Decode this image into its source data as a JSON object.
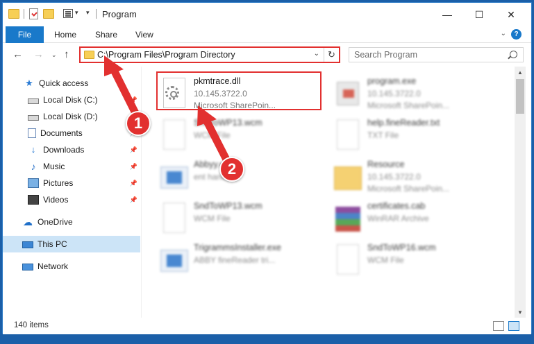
{
  "window": {
    "title": "Program",
    "minimize": "—",
    "maximize": "☐",
    "close": "✕"
  },
  "ribbon": {
    "file": "File",
    "home": "Home",
    "share": "Share",
    "view": "View",
    "help": "?"
  },
  "nav": {
    "back": "←",
    "forward": "→",
    "up": "↑",
    "address": "C:\\Program Files\\Program Directory",
    "refresh": "↻",
    "search_placeholder": "Search Program"
  },
  "sidebar": {
    "items": [
      {
        "label": "Quick access",
        "icon": "star-icon",
        "pinned": false
      },
      {
        "label": "Local Disk (C:)",
        "icon": "drive-icon",
        "pinned": true
      },
      {
        "label": "Local Disk (D:)",
        "icon": "drive-icon",
        "pinned": false
      },
      {
        "label": "Documents",
        "icon": "document-icon",
        "pinned": true
      },
      {
        "label": "Downloads",
        "icon": "download-icon",
        "pinned": true
      },
      {
        "label": "Music",
        "icon": "music-icon",
        "pinned": true
      },
      {
        "label": "Pictures",
        "icon": "pictures-icon",
        "pinned": true
      },
      {
        "label": "Videos",
        "icon": "videos-icon",
        "pinned": true
      },
      {
        "label": "OneDrive",
        "icon": "cloud-icon",
        "pinned": false
      },
      {
        "label": "This PC",
        "icon": "computer-icon",
        "pinned": false,
        "selected": true
      },
      {
        "label": "Network",
        "icon": "network-icon",
        "pinned": false
      }
    ]
  },
  "files": [
    {
      "name": "pkmtrace.dll",
      "line1": "10.145.3722.0",
      "line2": "Microsoft SharePoin...",
      "icon": "dll-gear-icon"
    },
    {
      "name": "program.exe",
      "line1": "10.145.3722.0",
      "line2": "Microsoft SharePoin...",
      "icon": "exe-icon"
    },
    {
      "name": "SndToWP13.wcm",
      "line1": "WCM File",
      "line2": "",
      "icon": "file-icon"
    },
    {
      "name": "help.fineReader.txt",
      "line1": "TXT File",
      "line2": "",
      "icon": "file-icon"
    },
    {
      "name": "Abbyy.exe",
      "line1": "ent hand...",
      "line2": "",
      "icon": "window-app-icon"
    },
    {
      "name": "Resource",
      "line1": "10.145.3722.0",
      "line2": "Microsoft SharePoin...",
      "icon": "folder-icon"
    },
    {
      "name": "SndToWP13.wcm",
      "line1": "WCM File",
      "line2": "",
      "icon": "file-icon"
    },
    {
      "name": "certificates.cab",
      "line1": "WinRAR Archive",
      "line2": "",
      "icon": "winrar-icon"
    },
    {
      "name": "TrigrammsInstaller.exe",
      "line1": "ABBY fineReader tri...",
      "line2": "",
      "icon": "window-app-icon"
    },
    {
      "name": "SndToWP16.wcm",
      "line1": "WCM File",
      "line2": "",
      "icon": "file-icon"
    }
  ],
  "status": {
    "count": "140 items"
  },
  "callouts": {
    "one": "1",
    "two": "2"
  },
  "colors": {
    "highlight": "#e2302f",
    "accent": "#1979ca",
    "background": "#1b5fa8"
  }
}
